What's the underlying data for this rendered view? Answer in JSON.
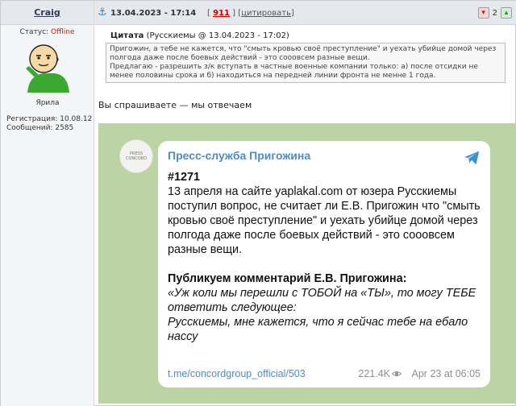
{
  "user": {
    "name": "Craig",
    "status_label": "Статус:",
    "status_value": "Offline",
    "rank": "Ярила",
    "registration": "Регистрация: 10.08.12",
    "messages": "Сообщений: 2585"
  },
  "post": {
    "date": "13.04.2023 - 17:14",
    "bracket_open": "[",
    "post_number": "911",
    "bracket_mid": "] [",
    "cite_label": "цитировать",
    "bracket_close": "]",
    "rating": "2"
  },
  "quote": {
    "label": "Цитата",
    "source": "(Русскиемы @ 13.04.2023 - 17:02)",
    "text": "Пригожин, а тебе не кажется, что \"смыть кровью своё преступление\" и уехать убийце домой через полгода даже после боевых действий - это сооовсем разные вещи.\nПредлагаю - разрешить з/к вступать в частные военные компании только: а) после отсидки не менее половины срока и б) находиться на передней линии фронта не менне 1 года."
  },
  "answer": "Вы спрашиваете — мы отвечаем",
  "telegram": {
    "avatar_text": "PRESS CONCORD",
    "channel": "Пресс-служба Пригожина",
    "number": "#1271",
    "paragraph1": "13 апреля на сайте yaplakal.com от юзера Русскиемы поступил вопрос, не считает ли Е.В. Пригожин что \"смыть кровью своё преступление\" и уехать убийце домой через полгода даже после боевых действий - это сооовсем разные вещи.",
    "heading": "Публикуем комментарий Е.В. Пригожина:",
    "italic": "«Уж коли мы перешли с ТОБОЙ на «ТЫ», то могу ТЕБЕ ответить следующее:\nРусскиемы, мне кажется, что я сейчас тебе на ебало нассу",
    "link": "t.me/concordgroup_official/503",
    "views": "221.4K",
    "time": "Apr 23 at 06:05"
  }
}
